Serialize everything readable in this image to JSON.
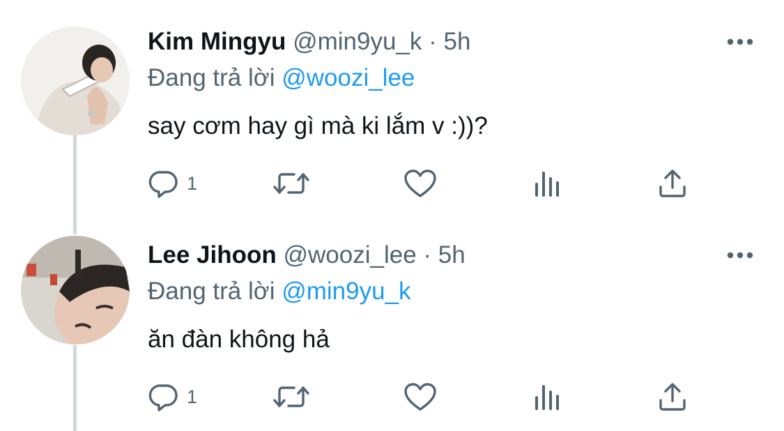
{
  "tweets": [
    {
      "name": "Kim Mingyu",
      "handle": "@min9yu_k",
      "separator": "·",
      "time": "5h",
      "replying_prefix": "Đang trả lời",
      "replying_to": "@woozi_lee",
      "text": "say cơm hay gì mà ki lắm v :))?",
      "reply_count": "1"
    },
    {
      "name": "Lee Jihoon",
      "handle": "@woozi_lee",
      "separator": "·",
      "time": "5h",
      "replying_prefix": "Đang trả lời",
      "replying_to": "@min9yu_k",
      "text": "ăn đàn không hả",
      "reply_count": "1"
    }
  ],
  "colors": {
    "icon": "#536471",
    "mention": "#1d9bf0",
    "thread_line": "#cfd9de",
    "text": "#0f1419"
  },
  "icons": [
    "more-icon",
    "reply-icon",
    "retweet-icon",
    "like-icon",
    "views-icon",
    "share-icon"
  ]
}
